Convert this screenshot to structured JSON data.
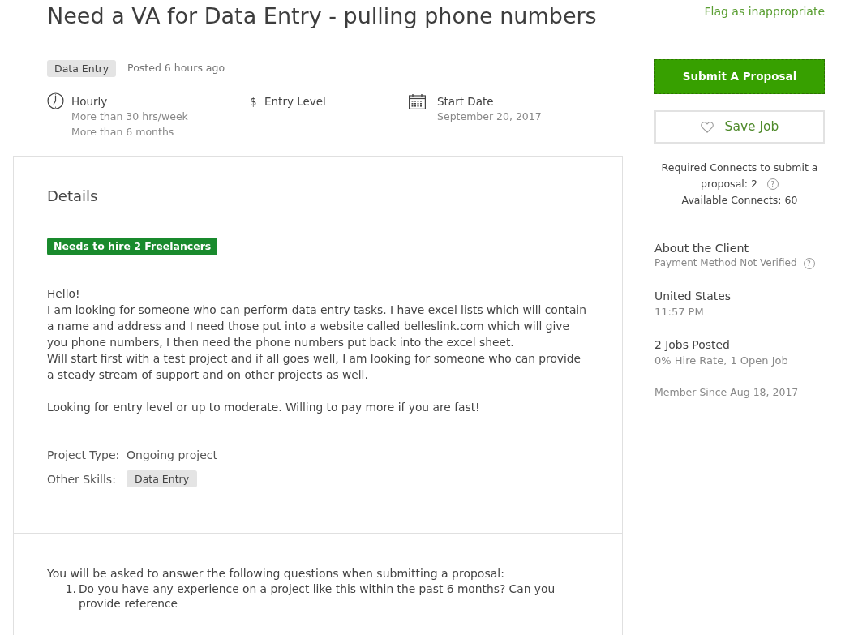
{
  "title": "Need a VA for Data Entry - pulling phone numbers",
  "category_tag": "Data Entry",
  "posted": "Posted 6 hours ago",
  "job_facts": [
    {
      "kind": "clock",
      "title": "Hourly",
      "details": [
        "More than 30 hrs/week",
        "More than 6 months"
      ]
    },
    {
      "kind": "symbol",
      "symbol": "$",
      "title": "Entry Level"
    },
    {
      "kind": "calendar",
      "title": "Start Date",
      "details": [
        "September 20, 2017"
      ]
    }
  ],
  "details": {
    "heading": "Details",
    "hire_badge": "Needs to hire 2 Freelancers",
    "description": [
      "Hello!\nI am looking for someone who can perform data entry tasks. I have excel lists which will contain a name and address and I need those put into a website called belleslink.com which will give you phone numbers, I then need the phone numbers put back into the excel sheet.\nWill start first with a test project and if all goes well, I am looking for someone who can provide a steady stream of support and on other projects as well.",
      "Looking for entry level or up to moderate. Willing to pay more if you are fast!"
    ],
    "project_type": {
      "label": "Project Type:",
      "value": "Ongoing project"
    },
    "other_skills": {
      "label": "Other Skills:",
      "tags": [
        "Data Entry"
      ]
    }
  },
  "questions": {
    "intro": "You will be asked to answer the following questions when submitting a proposal:",
    "items": [
      {
        "number": "1.",
        "text": "Do you have any experience on a project like this within the past 6 months? Can you provide reference"
      }
    ]
  },
  "sidebar": {
    "flag_link": "Flag as inappropriate",
    "buttons": [
      {
        "kind": "primary",
        "label": "Submit A Proposal"
      },
      {
        "kind": "save",
        "label": "Save Job"
      }
    ],
    "connects": {
      "required_lines": [
        "Required Connects to submit a",
        "proposal: 2"
      ],
      "help_icon": "?",
      "available": "Available Connects: 60"
    },
    "client": {
      "heading": "About the Client",
      "payment": "Payment Method Not Verified",
      "help_icon": "?",
      "groups": [
        {
          "title": "United States",
          "detail": "11:57 PM"
        },
        {
          "title": "2 Jobs Posted",
          "detail": "0% Hire Rate, 1 Open Job"
        }
      ],
      "member_since": "Member Since Aug 18, 2017"
    }
  }
}
